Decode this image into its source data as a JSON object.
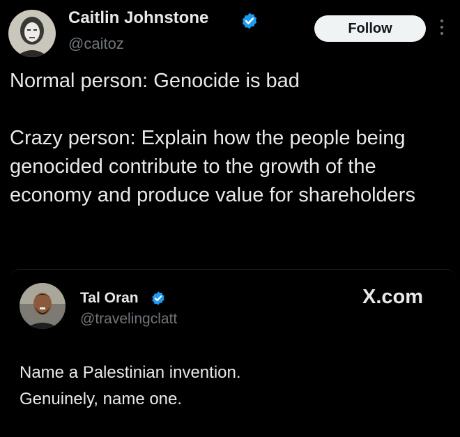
{
  "tweet": {
    "author_name": "Caitlin Johnstone",
    "author_handle": "@caitoz",
    "follow_label": "Follow",
    "text": "Normal person: Genocide is bad\n\nCrazy person: Explain how the people being genocided contribute to the growth of the economy and produce value for shareholders"
  },
  "quote": {
    "author_name": "Tal Oran",
    "author_handle": "@travelingclatt",
    "source": "X.com",
    "text": "Name a Palestinian invention.\nGenuinely, name one."
  },
  "colors": {
    "background": "#000000",
    "text": "#e7e9ea",
    "muted": "#71767b",
    "verified": "#1d9bf0",
    "button_bg": "#eff3f4"
  },
  "icons": {
    "verified": "verified-badge-icon",
    "more": "more-options-icon",
    "avatar": "user-avatar"
  }
}
